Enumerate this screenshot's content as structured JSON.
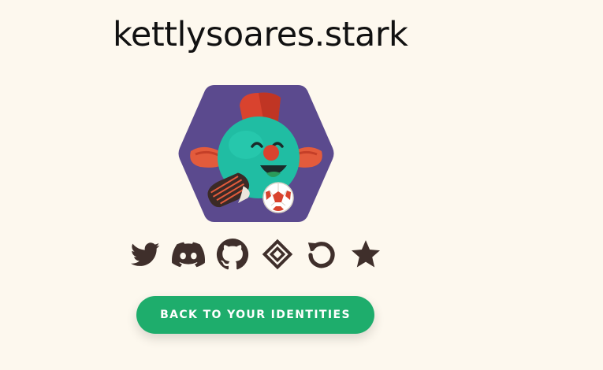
{
  "profile": {
    "username": "kettlysoares.stark"
  },
  "social_links": [
    {
      "name": "twitter-icon"
    },
    {
      "name": "discord-icon"
    },
    {
      "name": "github-icon"
    },
    {
      "name": "argent-icon"
    },
    {
      "name": "refresh-icon"
    },
    {
      "name": "star-icon"
    }
  ],
  "actions": {
    "back_label": "BACK TO YOUR IDENTITIES"
  },
  "colors": {
    "background": "#fdf8ee",
    "icon": "#3f2f2b",
    "button": "#1ead6c",
    "avatar_bg": "#5b4a8e"
  }
}
